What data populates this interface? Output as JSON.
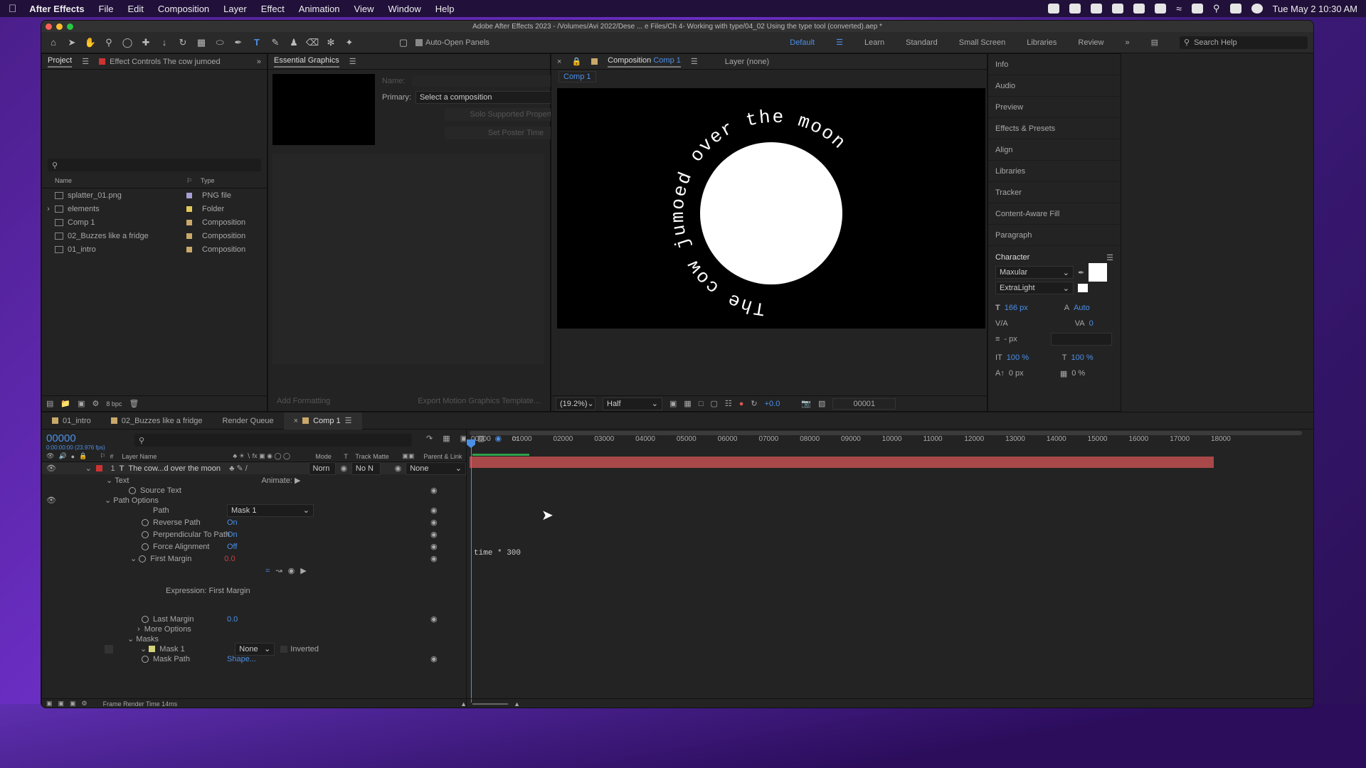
{
  "menubar": {
    "app": "After Effects",
    "items": [
      "File",
      "Edit",
      "Composition",
      "Layer",
      "Effect",
      "Animation",
      "View",
      "Window",
      "Help"
    ],
    "clock": "Tue May 2  10:30 AM"
  },
  "window": {
    "title": "Adobe After Effects 2023 - /Volumes/Avi 2022/Dese ... e Files/Ch 4- Working with type/04_02 Using the type tool (converted).aep *",
    "auto_open": "Auto-Open Panels",
    "workspaces": [
      "Default",
      "Learn",
      "Standard",
      "Small Screen",
      "Libraries",
      "Review"
    ],
    "search_help": "Search Help"
  },
  "project": {
    "tab": "Project",
    "effect_controls": "Effect Controls The cow jumoed",
    "col_name": "Name",
    "col_type": "Type",
    "bpc": "8 bpc",
    "items": [
      {
        "name": "splatter_01.png",
        "type": "PNG file",
        "color": "#a79fd3"
      },
      {
        "name": "elements",
        "type": "Folder",
        "color": "#e4c95a"
      },
      {
        "name": "Comp 1",
        "type": "Composition",
        "color": "#c9a86a"
      },
      {
        "name": "02_Buzzes like a fridge",
        "type": "Composition",
        "color": "#c9a86a"
      },
      {
        "name": "01_intro",
        "type": "Composition",
        "color": "#c9a86a"
      }
    ]
  },
  "essential": {
    "tab": "Essential Graphics",
    "name_label": "Name:",
    "primary_label": "Primary:",
    "primary_value": "Select a composition",
    "solo": "Solo Supported Properties",
    "poster": "Set Poster Time",
    "add_formatting": "Add Formatting",
    "export": "Export Motion Graphics Template..."
  },
  "comp": {
    "tab_label": "Composition",
    "tab_name": "Comp 1",
    "layer_tab": "Layer (none)",
    "sub_tab": "Comp 1",
    "path_text": "The cow jumoed over the moon",
    "zoom": "(19.2%)",
    "resolution": "Half",
    "exposure": "+0.0",
    "frame": "00001"
  },
  "right_panels": [
    "Info",
    "Audio",
    "Preview",
    "Effects & Presets",
    "Align",
    "Libraries",
    "Tracker",
    "Content-Aware Fill",
    "Paragraph"
  ],
  "character": {
    "title": "Character",
    "font": "Maxular",
    "style": "ExtraLight",
    "size": "166 px",
    "leading": "Auto",
    "kerning": "0",
    "stroke": "- px",
    "vscale": "100 %",
    "hscale": "100 %",
    "baseline": "0 px",
    "tsume": "0 %"
  },
  "timeline": {
    "tabs": [
      {
        "label": "01_intro",
        "color": "#c9a86a"
      },
      {
        "label": "02_Buzzes like a fridge",
        "color": "#c9a86a"
      },
      {
        "label": "Render Queue",
        "color": ""
      },
      {
        "label": "Comp 1",
        "color": "#c9a86a"
      }
    ],
    "timecode": "00000",
    "fps": "0:00:00:00 (23.976 fps)",
    "headers": {
      "layer_name": "Layer Name",
      "mode": "Mode",
      "t": "T",
      "track_matte": "Track Matte",
      "parent": "Parent & Link"
    },
    "layer": {
      "num": "1",
      "name": "The cow...d over the moon",
      "mode": "Norn",
      "matte": "No N",
      "parent": "None"
    },
    "animate": "Animate:",
    "props": {
      "text": "Text",
      "source_text": "Source Text",
      "path_options": "Path Options",
      "path": "Path",
      "path_value": "Mask 1",
      "reverse": "Reverse Path",
      "reverse_v": "On",
      "perp": "Perpendicular To Path",
      "perp_v": "On",
      "force": "Force Alignment",
      "force_v": "Off",
      "first": "First Margin",
      "first_v": "0.0",
      "expr_label": "Expression: First Margin",
      "last": "Last Margin",
      "last_v": "0.0",
      "more": "More Options",
      "masks": "Masks",
      "mask1": "Mask 1",
      "mask_mode": "None",
      "inverted": "Inverted",
      "mask_path": "Mask Path",
      "mask_path_v": "Shape..."
    },
    "expression": "time * 300",
    "ruler": [
      "00000",
      "01000",
      "02000",
      "03000",
      "04000",
      "05000",
      "06000",
      "07000",
      "08000",
      "09000",
      "10000",
      "11000",
      "12000",
      "13000",
      "14000",
      "15000",
      "16000",
      "17000",
      "18000"
    ],
    "render_time": "Frame Render Time  14ms"
  }
}
